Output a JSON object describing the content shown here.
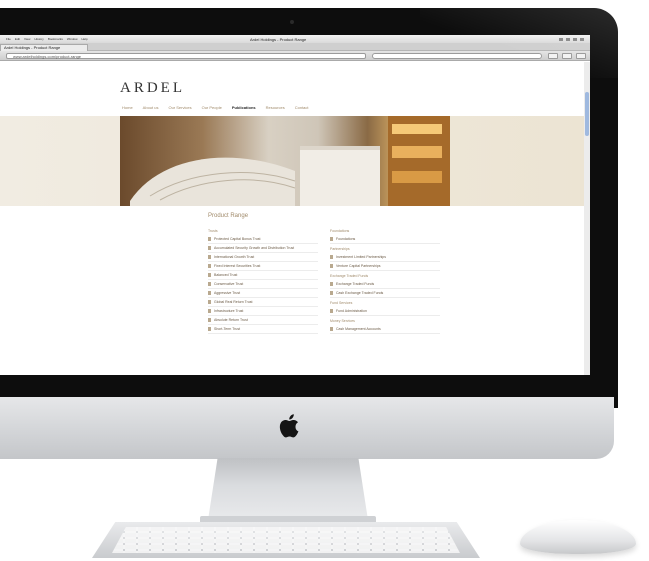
{
  "screen": {
    "window_title": "Ardel Holdings - Product Range",
    "tab_label": "Ardel Holdings - Product Range",
    "url": "www.ardelholdings.com/product-range",
    "menubar_items": [
      "",
      "File",
      "Edit",
      "View",
      "History",
      "Bookmarks",
      "Window",
      "Help"
    ]
  },
  "site": {
    "brand": "ARDEL",
    "nav": [
      "Home",
      "About us",
      "Our Services",
      "Our People",
      "Publications",
      "Resources",
      "Contact"
    ],
    "active_nav": "Publications",
    "content_title": "Product Range",
    "left_column": {
      "heading": "Trusts",
      "items": [
        "Protected Capital Bonus Trust",
        "Accumulated Security Growth and Distribution Trust",
        "International Growth Trust",
        "Fixed Interest Securities Trust",
        "Balanced Trust",
        "Conservative Trust",
        "Aggressive Trust",
        "Global Real Return Trust",
        "Infrastructure Trust",
        "Absolute Return Trust",
        "Short-Term Trust"
      ]
    },
    "right_column": {
      "sections": [
        {
          "heading": "Foundations",
          "items": [
            "Foundations"
          ]
        },
        {
          "heading": "Partnerships",
          "items": [
            "Investment Limited Partnerships",
            "Venture Capital Partnerships"
          ]
        },
        {
          "heading": "Exchange Traded Funds",
          "items": [
            "Exchange Traded Funds",
            "Cash Exchange Traded Funds"
          ]
        },
        {
          "heading": "Fund Services",
          "items": [
            "Fund Administration"
          ]
        },
        {
          "heading": "Money Services",
          "items": [
            "Cash Management Accounts"
          ]
        }
      ]
    }
  },
  "hardware": {
    "logo": "apple-logo"
  }
}
